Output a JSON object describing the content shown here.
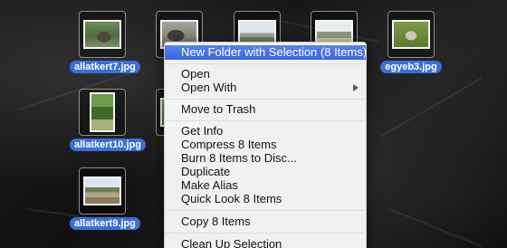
{
  "desktop": {
    "icons": [
      {
        "label": "allatkert7.jpg",
        "thumb": "duck"
      },
      {
        "label": "",
        "thumb": "animal"
      },
      {
        "label": "",
        "thumb": "zoo-building"
      },
      {
        "label": "",
        "thumb": "zoo-path"
      },
      {
        "label": "egyeb3.jpg",
        "thumb": "grass-animal"
      },
      {
        "label": "allatkert10.jpg",
        "thumb": "garden-portrait"
      },
      {
        "label": "",
        "thumb": "garden"
      },
      {
        "label": "allatkert9.jpg",
        "thumb": "palm-houses"
      }
    ]
  },
  "context_menu": {
    "items": [
      "New Folder with Selection (8 Items)",
      "Open",
      "Open With",
      "Move to Trash",
      "Get Info",
      "Compress 8 Items",
      "Burn 8 Items to Disc...",
      "Duplicate",
      "Make Alias",
      "Quick Look 8 Items",
      "Copy 8 Items",
      "Clean Up Selection"
    ],
    "highlight_color": "#3b6fd6"
  }
}
